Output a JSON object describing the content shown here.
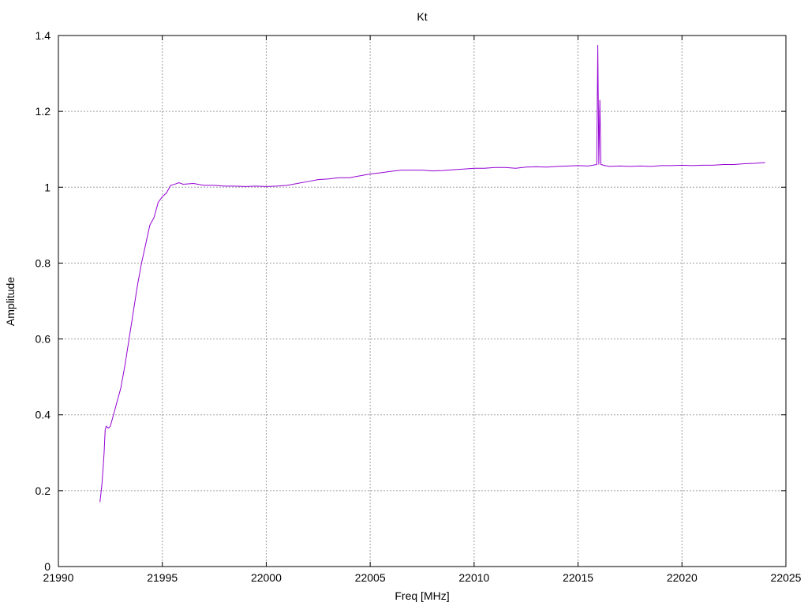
{
  "chart_data": {
    "type": "line",
    "title": "Kt",
    "xlabel": "Freq [MHz]",
    "ylabel": "Amplitude",
    "xlim": [
      21990,
      22025
    ],
    "ylim": [
      0,
      1.4
    ],
    "xticks": [
      21990,
      21995,
      22000,
      22005,
      22010,
      22015,
      22020,
      22025
    ],
    "yticks": [
      0,
      0.2,
      0.4,
      0.6,
      0.8,
      1,
      1.2,
      1.4
    ],
    "xtick_labels": [
      "21990",
      "21995",
      "22000",
      "22005",
      "22010",
      "22015",
      "22020",
      "22025"
    ],
    "ytick_labels": [
      "0",
      "0.2",
      "0.4",
      "0.6",
      "0.8",
      "1",
      "1.2",
      "1.4"
    ],
    "grid": true,
    "line_color": "#9400d3",
    "series": [
      {
        "x": [
          21992.0,
          21992.1,
          21992.2,
          21992.25,
          21992.3,
          21992.4,
          21992.5,
          21992.6,
          21992.8,
          21993.0,
          21993.2,
          21993.4,
          21993.6,
          21993.8,
          21994.0,
          21994.2,
          21994.4,
          21994.6,
          21994.8,
          21995.0,
          21995.2,
          21995.4,
          21995.6,
          21995.8,
          21996.0,
          21996.5,
          21997.0,
          21997.5,
          21998.0,
          21998.5,
          21999.0,
          21999.5,
          22000.0,
          22000.5,
          22001.0,
          22001.5,
          22002.0,
          22002.5,
          22003.0,
          22003.5,
          22004.0,
          22004.5,
          22005.0,
          22005.5,
          22006.0,
          22006.5,
          22007.0,
          22007.5,
          22008.0,
          22008.5,
          22009.0,
          22009.5,
          22010.0,
          22010.5,
          22011.0,
          22011.5,
          22012.0,
          22012.5,
          22013.0,
          22013.5,
          22014.0,
          22014.5,
          22015.0,
          22015.5,
          22015.9,
          22015.95,
          22016.0,
          22016.05,
          22016.1,
          22016.3,
          22016.5,
          22017.0,
          22017.5,
          22018.0,
          22018.5,
          22019.0,
          22019.5,
          22020.0,
          22020.5,
          22021.0,
          22021.5,
          22022.0,
          22022.5,
          22023.0,
          22023.5,
          22024.0
        ],
        "y": [
          0.17,
          0.22,
          0.3,
          0.36,
          0.37,
          0.365,
          0.37,
          0.39,
          0.43,
          0.47,
          0.53,
          0.6,
          0.67,
          0.74,
          0.8,
          0.85,
          0.9,
          0.92,
          0.96,
          0.975,
          0.985,
          1.005,
          1.008,
          1.012,
          1.008,
          1.01,
          1.005,
          1.005,
          1.003,
          1.003,
          1.002,
          1.003,
          1.002,
          1.003,
          1.005,
          1.01,
          1.015,
          1.02,
          1.022,
          1.025,
          1.025,
          1.03,
          1.035,
          1.038,
          1.042,
          1.045,
          1.045,
          1.045,
          1.043,
          1.044,
          1.046,
          1.048,
          1.05,
          1.05,
          1.052,
          1.052,
          1.05,
          1.053,
          1.054,
          1.053,
          1.055,
          1.056,
          1.057,
          1.056,
          1.06,
          1.375,
          1.06,
          1.23,
          1.06,
          1.057,
          1.055,
          1.056,
          1.055,
          1.056,
          1.055,
          1.057,
          1.057,
          1.058,
          1.057,
          1.058,
          1.058,
          1.06,
          1.06,
          1.062,
          1.063,
          1.065
        ]
      }
    ]
  }
}
